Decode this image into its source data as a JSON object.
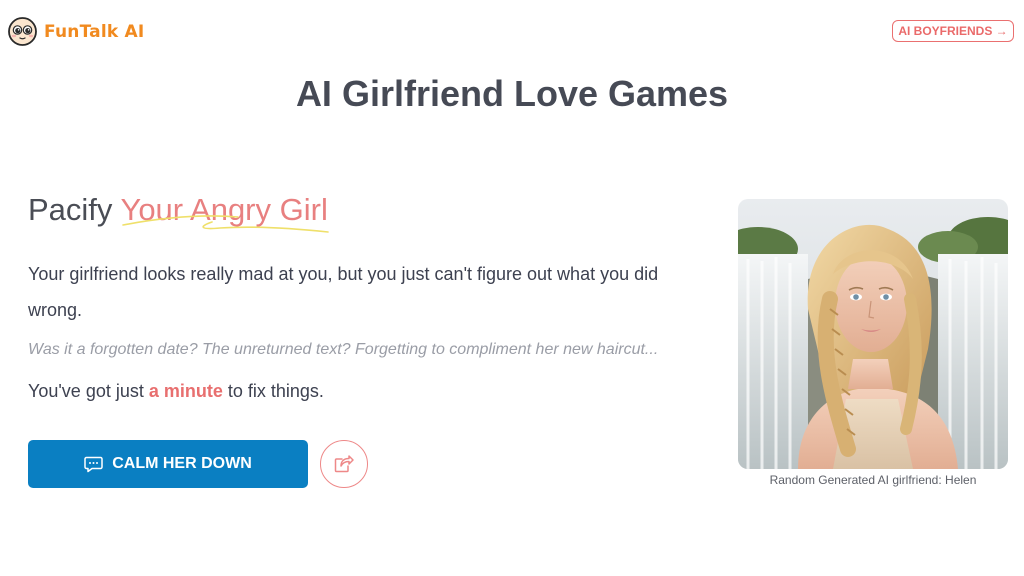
{
  "header": {
    "logo_text": "FunTalk AI",
    "logo_icon": "emoji-face-icon",
    "top_button_label": "AI BOYFRIENDS →"
  },
  "main": {
    "page_title": "AI Girlfriend Love Games",
    "game": {
      "heading_prefix": "Pacify ",
      "heading_accent": "Your Angry Girl",
      "intro": "Your girlfriend looks really mad at you, but you just can't figure out what you did wrong.",
      "hint": "Was it a forgotten date? The unreturned text? Forgetting to compliment her new haircut...",
      "deadline_prefix": "You've got just ",
      "deadline_emphasis": "a minute",
      "deadline_suffix": " to fix things.",
      "cta_label": "CALM HER DOWN",
      "cta_icon": "chat-bubble-icon",
      "share_icon": "share-icon"
    },
    "portrait": {
      "caption": "Random Generated AI girlfriend: Helen"
    }
  },
  "colors": {
    "accent_orange": "#f18a1f",
    "accent_pink": "#e88080",
    "primary_blue": "#0a7fc2",
    "title_gray": "#464a55"
  }
}
